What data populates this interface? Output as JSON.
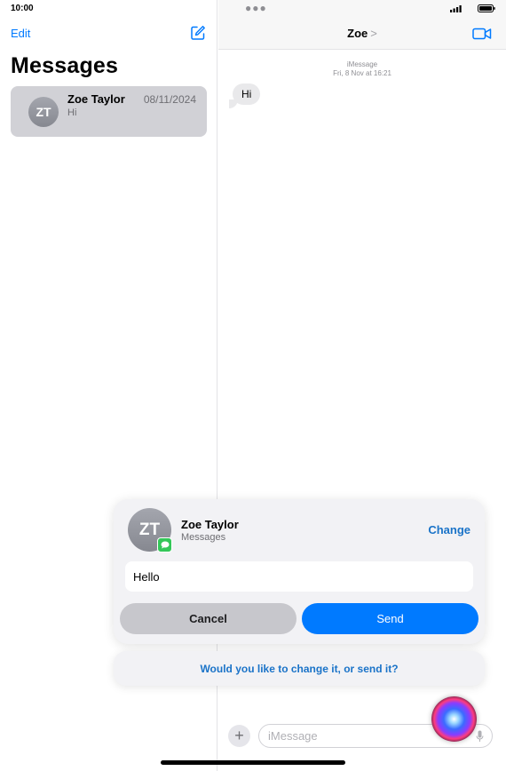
{
  "status_bar": {
    "time": "10:00"
  },
  "sidebar": {
    "edit_label": "Edit",
    "title": "Messages",
    "conversations": [
      {
        "initials": "ZT",
        "name": "Zoe Taylor",
        "date": "08/11/2024",
        "preview": "Hi"
      }
    ]
  },
  "chat": {
    "contact_name": "Zoe",
    "chevron": ">",
    "service_label": "iMessage",
    "timestamp": "Fri, 8 Nov at 16:21",
    "messages": [
      {
        "text": "Hi",
        "direction": "incoming"
      }
    ],
    "input_placeholder": "iMessage"
  },
  "siri": {
    "contact_initials": "ZT",
    "contact_name": "Zoe Taylor",
    "app_name": "Messages",
    "change_label": "Change",
    "message_text": "Hello",
    "cancel_label": "Cancel",
    "send_label": "Send",
    "prompt": "Would you like to change it, or send it?"
  },
  "colors": {
    "accent": "#007aff",
    "link": "#1a73c8",
    "imessage_green": "#34c759",
    "selected_row": "#d1d1d6"
  }
}
